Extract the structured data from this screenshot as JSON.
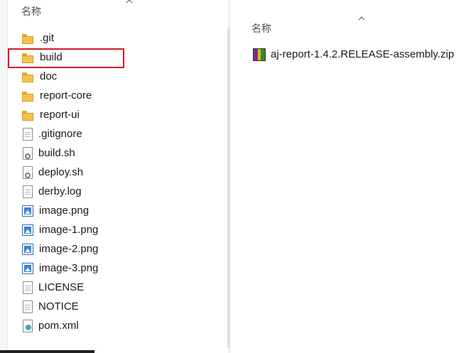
{
  "left_pane": {
    "column_header": "名称",
    "files": [
      {
        "name": ".git",
        "icon": "folder-icon"
      },
      {
        "name": "build",
        "icon": "folder-icon"
      },
      {
        "name": "doc",
        "icon": "folder-icon"
      },
      {
        "name": "report-core",
        "icon": "folder-icon"
      },
      {
        "name": "report-ui",
        "icon": "folder-icon"
      },
      {
        "name": ".gitignore",
        "icon": "text-file-icon"
      },
      {
        "name": "build.sh",
        "icon": "script-file-icon"
      },
      {
        "name": "deploy.sh",
        "icon": "script-file-icon"
      },
      {
        "name": "derby.log",
        "icon": "text-file-icon"
      },
      {
        "name": "image.png",
        "icon": "image-file-icon"
      },
      {
        "name": "image-1.png",
        "icon": "image-file-icon"
      },
      {
        "name": "image-2.png",
        "icon": "image-file-icon"
      },
      {
        "name": "image-3.png",
        "icon": "image-file-icon"
      },
      {
        "name": "LICENSE",
        "icon": "blank-file-icon"
      },
      {
        "name": "NOTICE",
        "icon": "blank-file-icon"
      },
      {
        "name": "pom.xml",
        "icon": "xml-file-icon"
      }
    ],
    "highlighted": "build"
  },
  "right_pane": {
    "column_header": "名称",
    "files": [
      {
        "name": "aj-report-1.4.2.RELEASE-assembly.zip",
        "icon": "zip-archive-icon"
      }
    ]
  },
  "colors": {
    "highlight_border": "#d01c2c",
    "folder": "#f4c150"
  }
}
